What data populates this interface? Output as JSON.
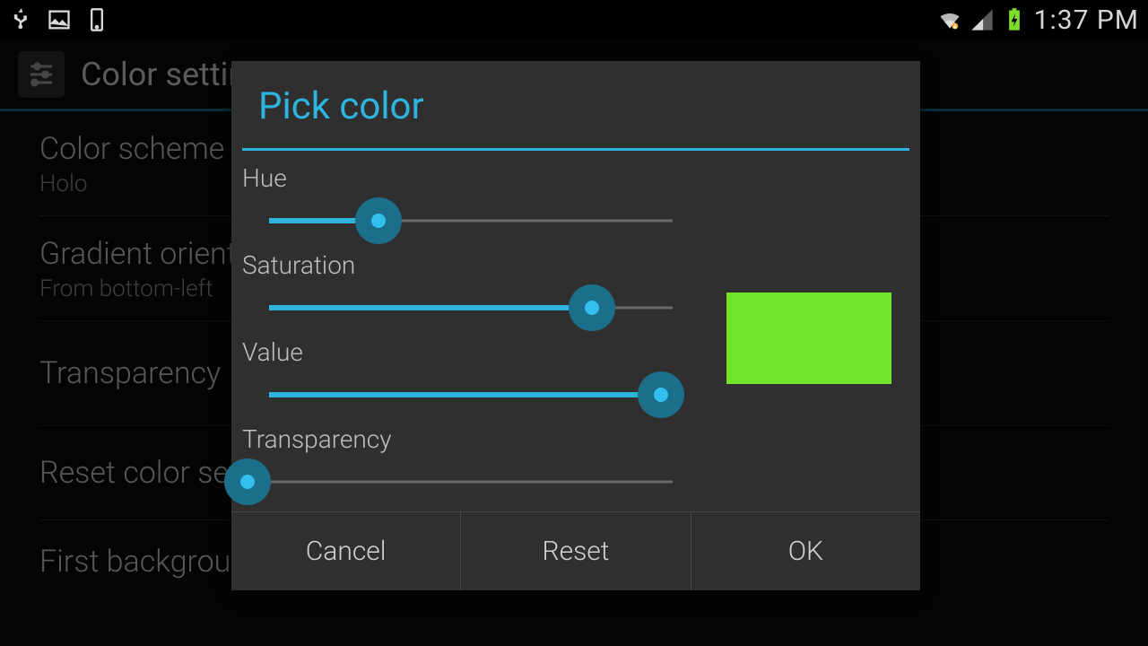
{
  "status": {
    "clock": "1:37 PM"
  },
  "actionbar": {
    "title": "Color settings"
  },
  "settings": {
    "item0": {
      "primary": "Color scheme",
      "secondary": "Holo"
    },
    "item1": {
      "primary": "Gradient orientation",
      "secondary": "From bottom-left"
    },
    "item2": {
      "primary": "Transparency"
    },
    "item3": {
      "primary": "Reset color settings"
    },
    "item4": {
      "primary": "First background color"
    }
  },
  "dialog": {
    "title": "Pick color",
    "sliders": {
      "hue": {
        "label": "Hue",
        "percent": 27
      },
      "saturation": {
        "label": "Saturation",
        "percent": 80
      },
      "value": {
        "label": "Value",
        "percent": 97
      },
      "transparency": {
        "label": "Transparency",
        "percent": 0
      }
    },
    "swatch_color": "#72e52b",
    "buttons": {
      "cancel": "Cancel",
      "reset": "Reset",
      "ok": "OK"
    }
  }
}
